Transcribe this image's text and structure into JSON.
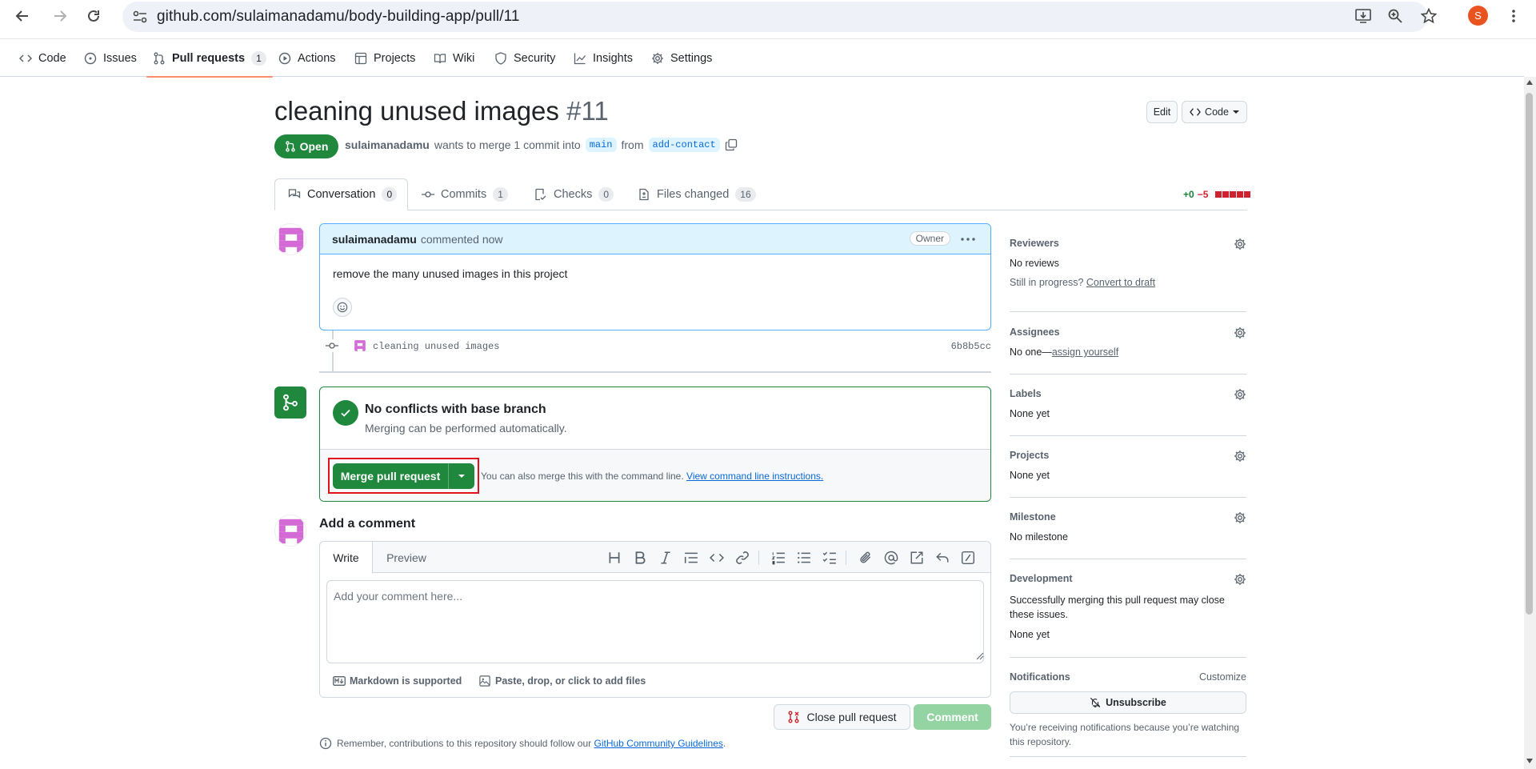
{
  "browser": {
    "url": "github.com/sulaimanadamu/body-building-app/pull/11",
    "profile_initial": "S"
  },
  "repo_nav": {
    "tabs": [
      {
        "label": "Code"
      },
      {
        "label": "Issues"
      },
      {
        "label": "Pull requests",
        "count": "1"
      },
      {
        "label": "Actions"
      },
      {
        "label": "Projects"
      },
      {
        "label": "Wiki"
      },
      {
        "label": "Security"
      },
      {
        "label": "Insights"
      },
      {
        "label": "Settings"
      }
    ]
  },
  "pr": {
    "title": "cleaning unused images",
    "number": "#11",
    "edit_label": "Edit",
    "code_label": "Code",
    "state": "Open",
    "author": "sulaimanadamu",
    "merge_text": "wants to merge 1 commit into",
    "base_branch": "main",
    "from_text": "from",
    "head_branch": "add-contact"
  },
  "pr_tabs": [
    {
      "label": "Conversation",
      "count": "0"
    },
    {
      "label": "Commits",
      "count": "1"
    },
    {
      "label": "Checks",
      "count": "0"
    },
    {
      "label": "Files changed",
      "count": "16"
    }
  ],
  "diffstat": {
    "added": "+0",
    "removed": "−5"
  },
  "comment": {
    "author": "sulaimanadamu",
    "time_text": "commented now",
    "badge": "Owner",
    "body": "remove the many unused images in this project"
  },
  "commit": {
    "message": "cleaning unused images",
    "sha": "6b8b5cc"
  },
  "merge": {
    "title": "No conflicts with base branch",
    "subtitle": "Merging can be performed automatically.",
    "button": "Merge pull request",
    "hint": "You can also merge this with the command line.",
    "hint_link": "View command line instructions."
  },
  "add_comment": {
    "heading": "Add a comment",
    "tab_write": "Write",
    "tab_preview": "Preview",
    "placeholder": "Add your comment here...",
    "markdown_note": "Markdown is supported",
    "files_note": "Paste, drop, or click to add files",
    "close_button": "Close pull request",
    "comment_button": "Comment",
    "guidelines_text": "Remember, contributions to this repository should follow our",
    "guidelines_link": "GitHub Community Guidelines",
    "guidelines_end": "."
  },
  "sidebar": {
    "reviewers": {
      "title": "Reviewers",
      "value": "No reviews",
      "progress_text": "Still in progress?",
      "progress_link": "Convert to draft"
    },
    "assignees": {
      "title": "Assignees",
      "value": "No one—",
      "link": "assign yourself"
    },
    "labels": {
      "title": "Labels",
      "value": "None yet"
    },
    "projects": {
      "title": "Projects",
      "value": "None yet"
    },
    "milestone": {
      "title": "Milestone",
      "value": "No milestone"
    },
    "development": {
      "title": "Development",
      "desc": "Successfully merging this pull request may close these issues.",
      "value": "None yet"
    },
    "notifications": {
      "title": "Notifications",
      "customize": "Customize",
      "button": "Unsubscribe",
      "desc": "You’re receiving notifications because you’re watching this repository."
    }
  },
  "colors": {
    "accent_green": "#1f883d",
    "link_blue": "#0969da",
    "highlight_red": "#e1121e"
  }
}
